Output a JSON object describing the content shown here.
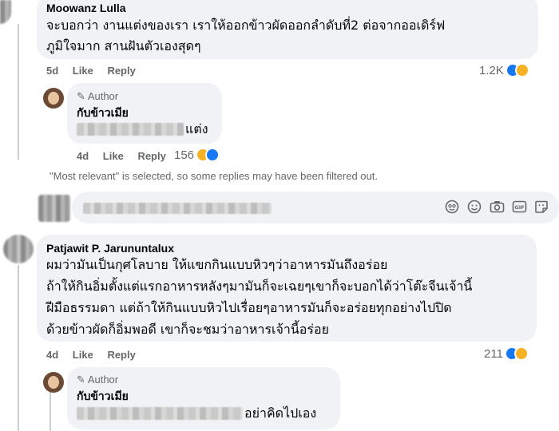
{
  "comments": [
    {
      "name": "Moowanz Lulla",
      "lines": [
        "จะบอกว่า งานแต่งของเรา เราให้ออกข้าวผัดออกลำดับที่2 ต่อจากออเดิร์ฟ",
        "ภูมิใจมาก สานฝันตัวเองสุดๆ"
      ],
      "time": "5d",
      "like": "Like",
      "reply": "Reply",
      "count": "1.2K"
    },
    {
      "name": "Patjawit P. Jarununtalux",
      "lines": [
        "ผมว่ามันเป็นกุศโลบาย ให้แขกกินแบบหิวๆว่าอาหารมันถึงอร่อย",
        "ถ้าให้กินอิ่มตั้งแต่แรกอาหารหลังๆมามันก็จะเฉยๆเขาก็จะบอกได้ว่าโต๊ะจีนเจ้านี้",
        "ฝีมือธรรมดา แต่ถ้าให้กินแบบหิวไปเรื่อยๆอาหารมันก็จะอร่อยทุกอย่างไปปิด",
        "ด้วยข้าวผัดก็อิ่มพอดี เขาก็จะชมว่าอาหารเจ้านี้อร่อย"
      ],
      "time": "4d",
      "like": "Like",
      "reply": "Reply",
      "count": "211"
    }
  ],
  "replies": [
    {
      "author_badge": "Author",
      "name": "กับข้าวเมีย",
      "text_tail": "แต่ง",
      "time": "4d",
      "like": "Like",
      "reply": "Reply",
      "count": "156"
    },
    {
      "author_badge": "Author",
      "name": "กับข้าวเมีย",
      "text_tail": "อย่าคิดไปเอง"
    }
  ],
  "filter_notice": "\"Most relevant\" is selected, so some replies may have been filtered out.",
  "composer": {
    "icons": [
      "avatar-sticker-icon",
      "emoji-icon",
      "camera-icon",
      "gif-icon",
      "sticker-icon"
    ]
  }
}
